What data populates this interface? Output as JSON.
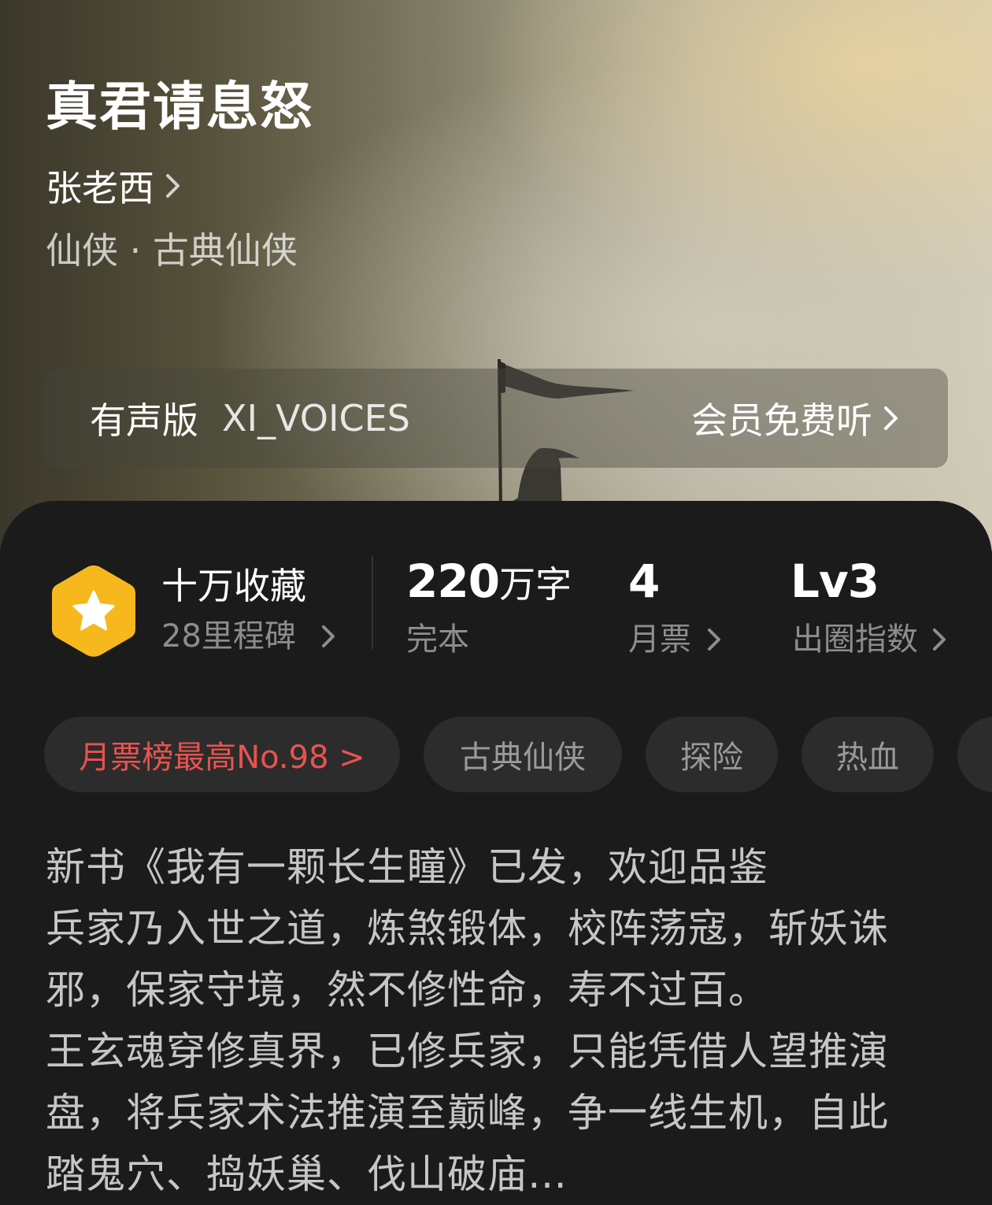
{
  "book": {
    "title": "真君请息怒",
    "author": "张老西",
    "genre_line": "仙侠 · 古典仙侠"
  },
  "audio": {
    "label": "有声版",
    "narrator": "XI_VOICES",
    "cta": "会员免费听"
  },
  "stats": {
    "collections": {
      "main": "十万收藏",
      "sub": "28里程碑"
    },
    "words": {
      "number": "220",
      "unit": "万字",
      "sub": "完本"
    },
    "tickets": {
      "number": "4",
      "sub": "月票"
    },
    "circle": {
      "main": "Lv3",
      "sub": "出圈指数"
    }
  },
  "tags": [
    "月票榜最高No.98 >",
    "古典仙侠",
    "探险",
    "热血"
  ],
  "synopsis": [
    "新书《我有一颗长生瞳》已发，欢迎品鉴",
    "兵家乃入世之道，炼煞锻体，校阵荡寇，斩妖诛",
    "邪，保家守境，然不修性命，寿不过百。",
    "王玄魂穿修真界，已修兵家，只能凭借人望推演",
    "盘，将兵家术法推演至巅峰，争一线生机，自此",
    "踏鬼穴、捣妖巢、伐山破庙…"
  ],
  "colors": {
    "accent_rank": "#e8534f",
    "badge": "#f6b81c",
    "background": "#1b1b1b"
  },
  "icons": {
    "badge": "star-badge-icon",
    "chevron": "chevron-right-icon"
  }
}
